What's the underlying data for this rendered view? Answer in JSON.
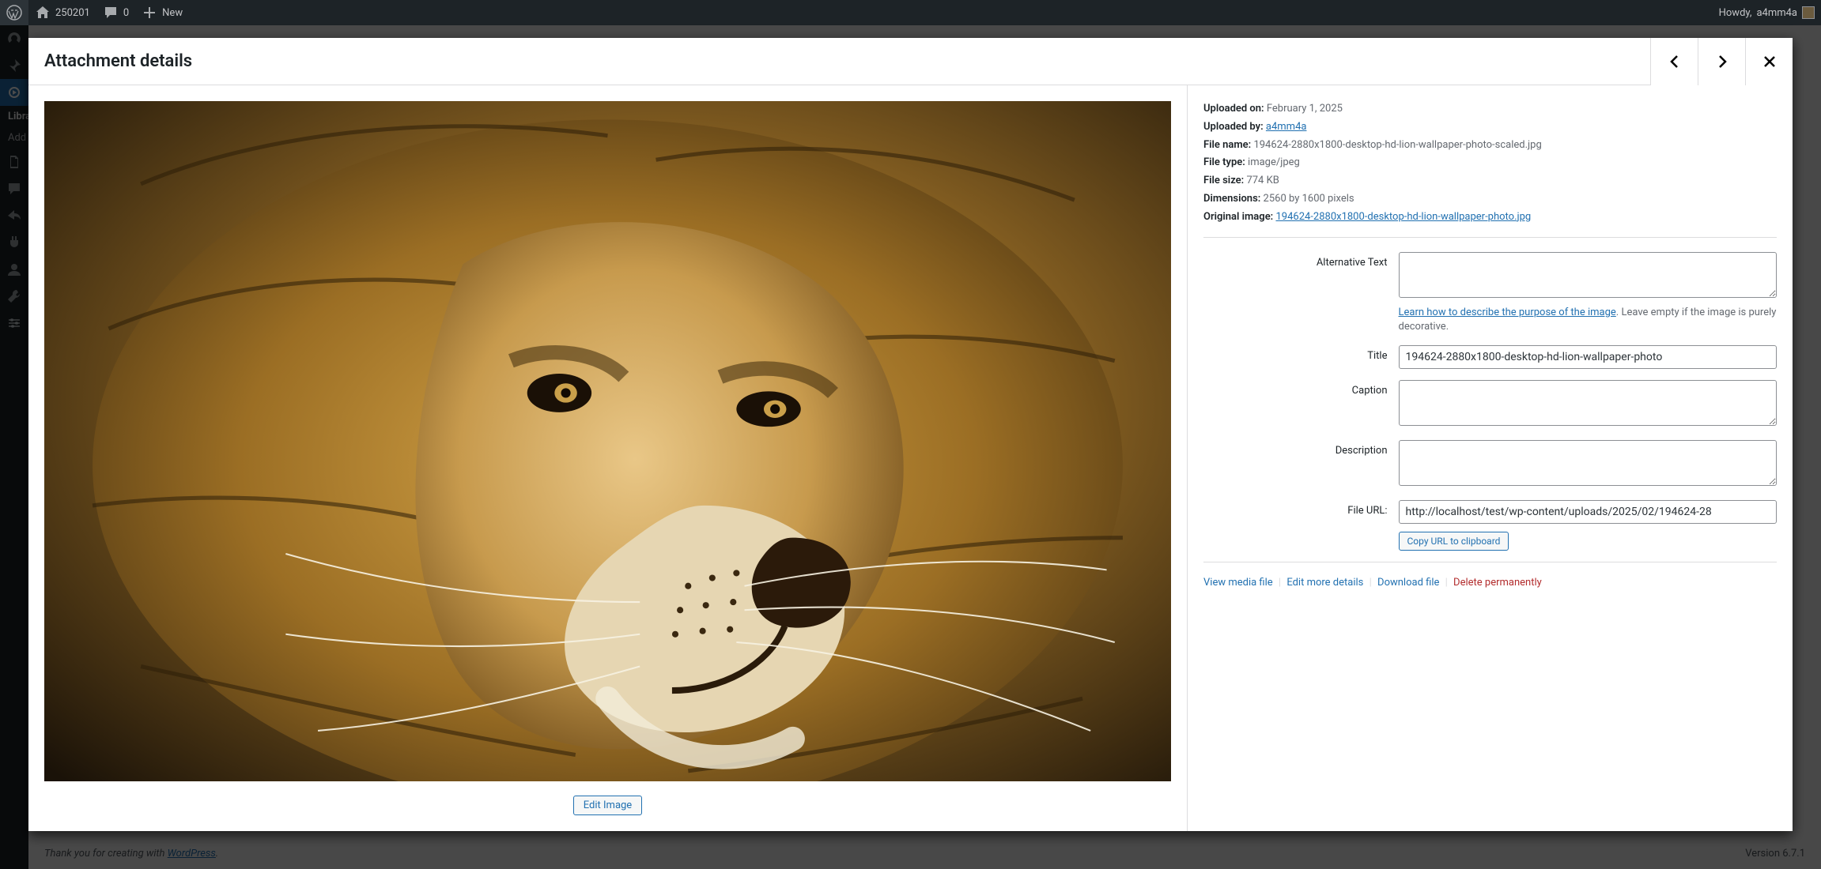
{
  "adminbar": {
    "site_name": "250201",
    "comments_count": "0",
    "new_label": "New",
    "howdy_prefix": "Howdy, ",
    "user": "a4mm4a"
  },
  "sidebar": {
    "sub_library": "Library",
    "sub_add_new": "Add"
  },
  "modal": {
    "title": "Attachment details"
  },
  "details": {
    "uploaded_on_label": "Uploaded on:",
    "uploaded_on_value": "February 1, 2025",
    "uploaded_by_label": "Uploaded by:",
    "uploaded_by_value": "a4mm4a",
    "file_name_label": "File name:",
    "file_name_value": "194624-2880x1800-desktop-hd-lion-wallpaper-photo-scaled.jpg",
    "file_type_label": "File type:",
    "file_type_value": "image/jpeg",
    "file_size_label": "File size:",
    "file_size_value": "774 KB",
    "dimensions_label": "Dimensions:",
    "dimensions_value": "2560 by 1600 pixels",
    "original_image_label": "Original image:",
    "original_image_value": "194624-2880x1800-desktop-hd-lion-wallpaper-photo.jpg"
  },
  "fields": {
    "alt_label": "Alternative Text",
    "alt_value": "",
    "alt_help_link": "Learn how to describe the purpose of the image",
    "alt_help_rest": ". Leave empty if the image is purely decorative.",
    "title_label": "Title",
    "title_value": "194624-2880x1800-desktop-hd-lion-wallpaper-photo",
    "caption_label": "Caption",
    "caption_value": "",
    "description_label": "Description",
    "description_value": "",
    "file_url_label": "File URL:",
    "file_url_value": "http://localhost/test/wp-content/uploads/2025/02/194624-28",
    "copy_url_label": "Copy URL to clipboard"
  },
  "actions": {
    "view": "View media file",
    "edit_more": "Edit more details",
    "download": "Download file",
    "delete": "Delete permanently"
  },
  "edit_image_label": "Edit Image",
  "footer": {
    "thanks_prefix": "Thank you for creating with ",
    "wp_label": "WordPress",
    "thanks_suffix": ".",
    "version": "Version 6.7.1"
  }
}
